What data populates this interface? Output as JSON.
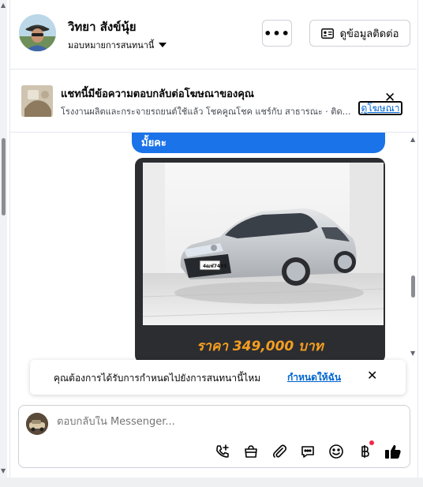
{
  "header": {
    "contact_name": "วิทยา สังข์นุ้ย",
    "assign_label": "มอบหมายการสนทนานี้",
    "more_label": "•••",
    "view_info_label": "ดูข้อมูลติดต่อ"
  },
  "ad_banner": {
    "title": "แชทนี้มีข้อความตอบกลับต่อโฆษณาของคุณ",
    "subtitle": "โรงงานผลิตและกระจายรถยนต์ใช้แล้ว โชคคูณโชค แชร์กับ สาธารณะ · ติดต...",
    "link_label": "ดูโฆษณา",
    "close_label": "✕"
  },
  "chat": {
    "bubble_text": "มั้ยคะ",
    "car_plate": "4ฒฬ7495",
    "price_text": "ราคา 349,000 บาท"
  },
  "toast": {
    "text": "คุณต้องการได้รับการกำหนดไปยังการสนทนานี้ไหม",
    "link_label": "กำหนดให้ฉัน",
    "close_label": "✕"
  },
  "composer": {
    "placeholder": "ตอบกลับใน Messenger...",
    "tools": [
      "phone-plus-icon",
      "shopping-bag-icon",
      "paperclip-icon",
      "chat-bubble-icon",
      "emoji-icon",
      "baht-icon",
      "thumbs-up-icon"
    ]
  },
  "colors": {
    "accent": "#1a73e8",
    "link": "#0064d1",
    "price": "#f59e20",
    "notification_dot": "#f02849",
    "card_bg": "#2b2d31"
  }
}
